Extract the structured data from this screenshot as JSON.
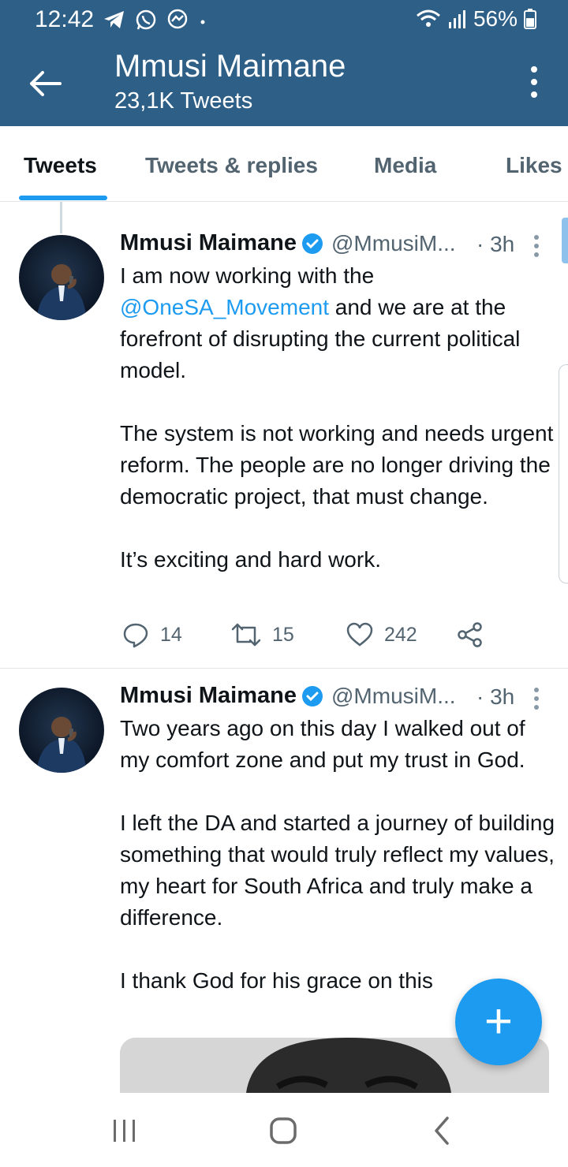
{
  "status_bar": {
    "time": "12:42",
    "battery": "56%",
    "left_icons": [
      "telegram-icon",
      "whatsapp-icon",
      "messenger-icon",
      "dot-icon"
    ],
    "right_icons": [
      "wifi-icon",
      "signal-icon",
      "battery-icon"
    ]
  },
  "app_bar": {
    "title": "Mmusi Maimane",
    "subtitle": "23,1K Tweets"
  },
  "tabs": [
    {
      "label": "Tweets",
      "active": true
    },
    {
      "label": "Tweets & replies",
      "active": false
    },
    {
      "label": "Media",
      "active": false
    },
    {
      "label": "Likes",
      "active": false
    }
  ],
  "tweets": [
    {
      "name": "Mmusi Maimane",
      "handle": "@MmusiM...",
      "time": "· 3h",
      "paragraphs": [
        {
          "before": "I am now working with the ",
          "mention": "@OneSA_Movement",
          "after": " and we are at the forefront of disrupting the current political model."
        },
        {
          "text": "The system is not working and needs urgent reform. The people are no longer driving the democratic project, that must change."
        },
        {
          "text": "It’s exciting and hard work."
        }
      ],
      "replies": "14",
      "retweets": "15",
      "likes": "242"
    },
    {
      "name": "Mmusi Maimane",
      "handle": "@MmusiM...",
      "time": "· 3h",
      "paragraphs": [
        {
          "text": "Two years ago on this day I walked out of my comfort zone and put my trust in God."
        },
        {
          "text": "I left the DA and started a journey of building something that would truly reflect my values, my heart for South Africa and truly make a difference."
        },
        {
          "text": "I thank God for his grace on this"
        }
      ]
    }
  ],
  "fab": {
    "label": "+"
  },
  "colors": {
    "header_bg": "#2e5f87",
    "accent": "#1d9bf0",
    "text_primary": "#0f1419",
    "text_secondary": "#536471"
  }
}
